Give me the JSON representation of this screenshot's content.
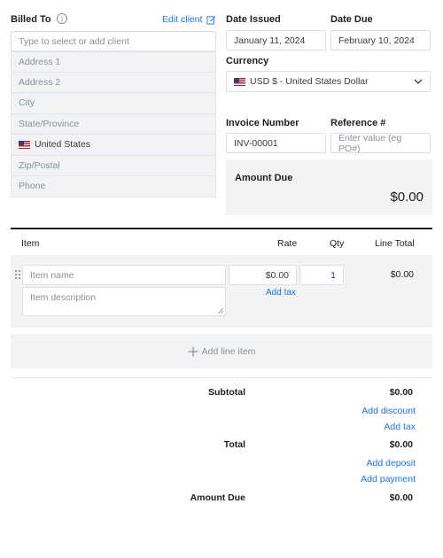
{
  "billed_to": {
    "label": "Billed To",
    "edit_client": "Edit client",
    "client_placeholder": "Type to select or add client",
    "address1": "Address 1",
    "address2": "Address 2",
    "city": "City",
    "state": "State/Province",
    "country": "United States",
    "zip": "Zip/Postal",
    "phone": "Phone"
  },
  "dates": {
    "issued_label": "Date Issued",
    "issued_value": "January 11, 2024",
    "due_label": "Date Due",
    "due_value": "February 10, 2024"
  },
  "currency": {
    "label": "Currency",
    "value": "USD $ - United States Dollar"
  },
  "invoice": {
    "number_label": "Invoice Number",
    "number_value": "INV-00001",
    "reference_label": "Reference #",
    "reference_placeholder": "Enter value (eg PO#)"
  },
  "amount_due_box": {
    "label": "Amount Due",
    "value": "$0.00"
  },
  "table": {
    "headers": {
      "item": "Item",
      "rate": "Rate",
      "qty": "Qty",
      "line_total": "Line Total"
    },
    "row": {
      "item_placeholder": "Item name",
      "description_placeholder": "Item description",
      "rate": "$0.00",
      "qty": "1",
      "line_total": "$0.00",
      "add_tax": "Add tax"
    },
    "add_line_item": "Add line item"
  },
  "totals": {
    "subtotal_label": "Subtotal",
    "subtotal_value": "$0.00",
    "add_discount": "Add discount",
    "add_tax": "Add tax",
    "total_label": "Total",
    "total_value": "$0.00",
    "add_deposit": "Add deposit",
    "add_payment": "Add payment",
    "amount_due_label": "Amount Due",
    "amount_due_value": "$0.00"
  },
  "icons": {
    "info": "info-icon",
    "edit": "pencil-edit-icon",
    "chevron": "chevron-down-icon",
    "drag": "drag-handle-icon",
    "plus": "plus-icon"
  }
}
